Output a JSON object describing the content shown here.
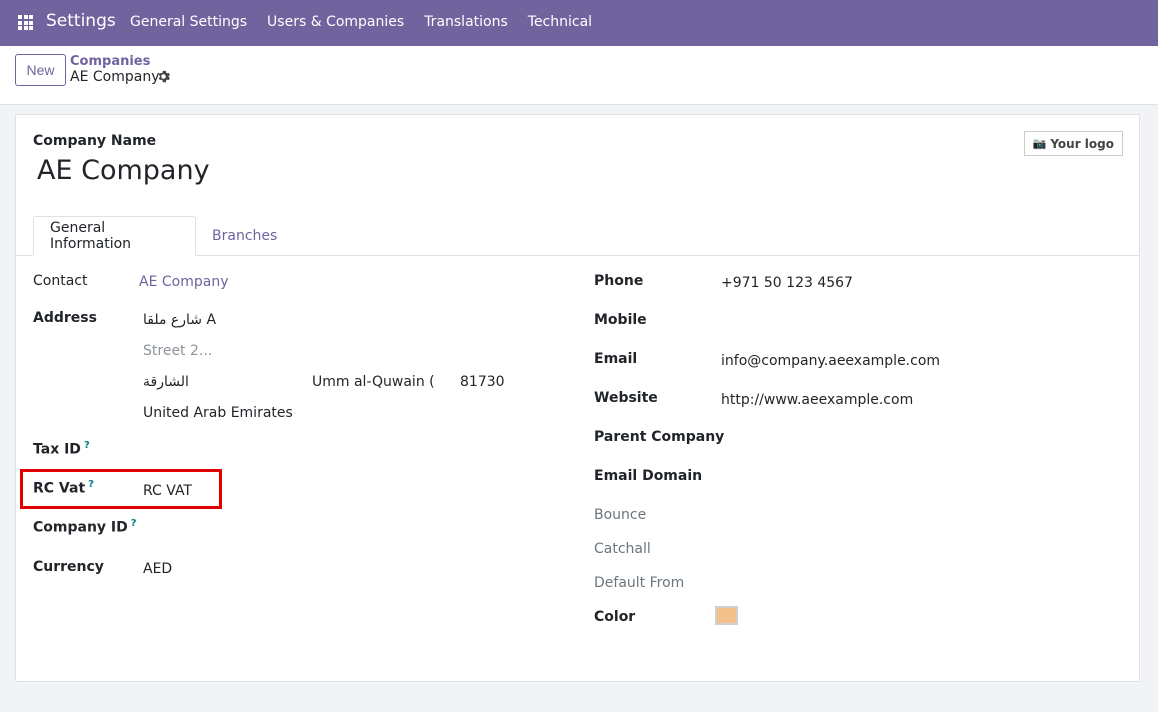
{
  "navbar": {
    "brand": "Settings",
    "menu": [
      "General Settings",
      "Users & Companies",
      "Translations",
      "Technical"
    ]
  },
  "control": {
    "new_label": "New",
    "breadcrumb_parent": "Companies",
    "breadcrumb_current": "AE Company"
  },
  "form": {
    "company_name_label": "Company Name",
    "company_name": "AE Company",
    "logo_label": "Your logo",
    "tabs": [
      "General Information",
      "Branches"
    ],
    "left": {
      "contact_label": "Contact",
      "contact_value": "AE Company",
      "address_label": "Address",
      "street": "شارع ملقا A",
      "street2_placeholder": "Street 2...",
      "city": "الشارقة",
      "state": "Umm al-Quwain (AE)",
      "zip": "81730",
      "country": "United Arab Emirates",
      "tax_id_label": "Tax ID",
      "rc_vat_label": "RC Vat",
      "rc_vat_value": "RC VAT",
      "company_id_label": "Company ID",
      "currency_label": "Currency",
      "currency_value": "AED",
      "help_mark": "?"
    },
    "right": {
      "phone_label": "Phone",
      "phone_value": "+971 50 123 4567",
      "mobile_label": "Mobile",
      "email_label": "Email",
      "email_value": "info@company.aeexample.com",
      "website_label": "Website",
      "website_value": "http://www.aeexample.com",
      "parent_company_label": "Parent Company",
      "email_domain_label": "Email Domain",
      "bounce_label": "Bounce",
      "catchall_label": "Catchall",
      "default_from_label": "Default From",
      "color_label": "Color",
      "color_value": "#f4c08c"
    }
  },
  "colors": {
    "brand": "#71639e",
    "highlight": "#e00000"
  }
}
